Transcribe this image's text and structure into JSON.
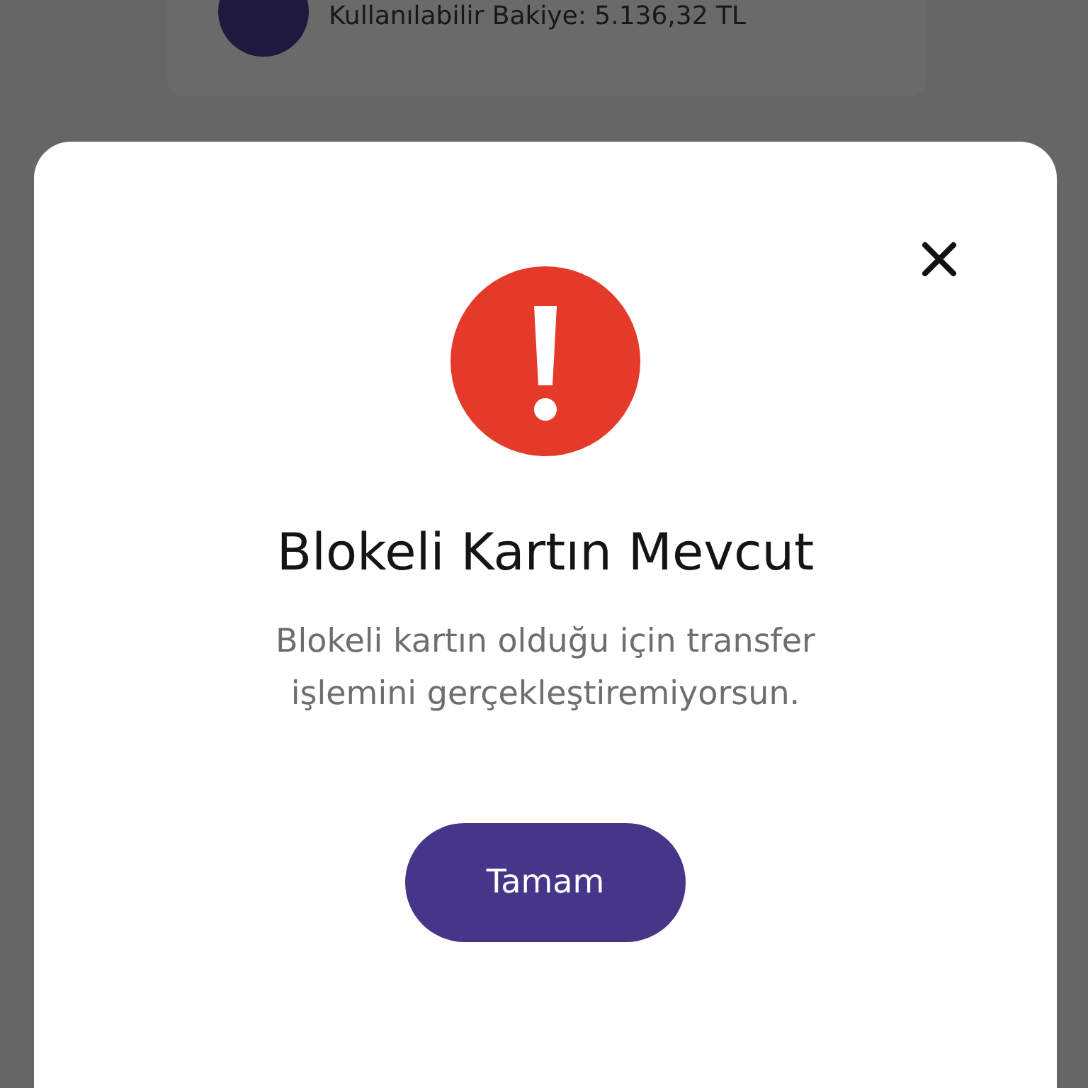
{
  "background_card": {
    "balance_text": "Kullanılabilir Bakiye: 5.136,32 TL"
  },
  "dialog": {
    "title": "Blokeli Kartın Mevcut",
    "message": "Blokeli kartın olduğu için transfer işlemini gerçekleştiremiyorsun.",
    "button": "Tamam"
  }
}
